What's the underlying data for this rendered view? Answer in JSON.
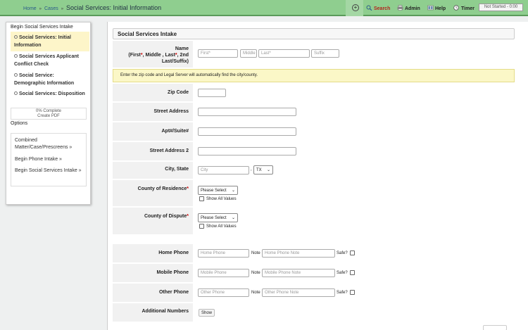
{
  "topbar": {
    "breadcrumb": {
      "home": "Home",
      "cases": "Cases",
      "current": "Social Services: Initial Information"
    },
    "plus": "+",
    "search": "Search",
    "admin": "Admin",
    "help": "Help",
    "timer": "Timer",
    "status": "Not Started - 0:00"
  },
  "sidebar": {
    "title": "Begin Social Services Intake",
    "steps": [
      {
        "label": "Social Services: Initial Information"
      },
      {
        "label": "Social Services Applicant Conflict Check"
      },
      {
        "label": "Social Service: Demographic Information"
      },
      {
        "label": "Social Services: Disposition"
      }
    ],
    "progress": "0% Complete",
    "pdf": "Create PDF",
    "options_label": "Options",
    "links": [
      {
        "label": "Combined Matter/Case/Prescreens »"
      },
      {
        "label": "Begin Phone Intake »"
      },
      {
        "label": "Begin Social Services Intake »"
      }
    ]
  },
  "form": {
    "section_title": "Social Services Intake",
    "name": {
      "label_a": "Name",
      "label_b": "(First",
      "label_c": ", Middle , Last",
      "label_d": ", 2nd",
      "label_e": "Last/Suffix)",
      "first_ph": "First*",
      "middle_ph": "Middle",
      "last_ph": "Last*",
      "suffix_ph": "Suffix"
    },
    "notice": "Enter the zip code and Legal Server will automatically find the city/county.",
    "zip_label": "Zip Code",
    "street_label": "Street Address",
    "apt_label": "Apt#/Suite#",
    "street2_label": "Street Address 2",
    "city_label": "City, State",
    "city_ph": "City",
    "city_sep": ",",
    "state_value": "TX",
    "county_res_label": "County of Residence",
    "county_disp_label": "County of Dispute",
    "please_select": "Please Select",
    "show_all": "Show All Values",
    "phones": [
      {
        "label": "Home Phone",
        "phone_ph": "Home Phone",
        "note_ph": "Home Phone Note"
      },
      {
        "label": "Mobile Phone",
        "phone_ph": "Mobile Phone",
        "note_ph": "Mobile Phone Note"
      },
      {
        "label": "Other Phone",
        "phone_ph": "Other Phone",
        "note_ph": "Other Phone Note"
      }
    ],
    "note_label": "Note",
    "safe_label": "Safe?",
    "additional_label": "Additional Numbers",
    "show_button": "Show"
  }
}
